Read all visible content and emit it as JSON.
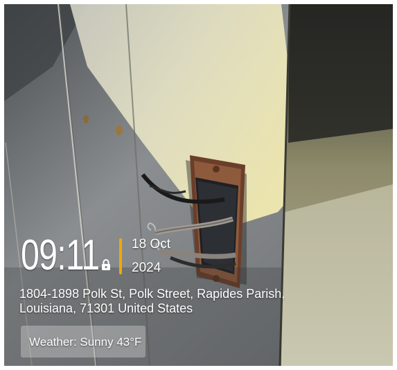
{
  "overlay": {
    "time": "09:11",
    "lock_icon": "lock-icon",
    "date_day": "18 Oct",
    "date_year": "2024",
    "address": "1804-1898 Polk St, Polk Street, Rapides Parish, Louisiana, 71301 United States",
    "weather": "Weather: Sunny 43°F",
    "accent_color": "#f2a900"
  }
}
